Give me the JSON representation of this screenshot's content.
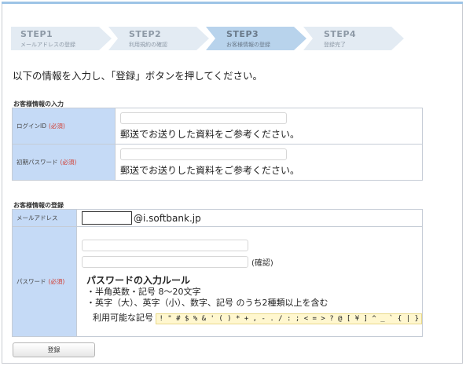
{
  "steps": [
    {
      "num": "STEP1",
      "desc": "メールアドレスの登録",
      "active": false
    },
    {
      "num": "STEP2",
      "desc": "利用規約の確認",
      "active": false
    },
    {
      "num": "STEP3",
      "desc": "お客様情報の登録",
      "active": true
    },
    {
      "num": "STEP4",
      "desc": "登録完了",
      "active": false
    }
  ],
  "intro": "以下の情報を入力し、「登録」ボタンを押してください。",
  "section1": {
    "title": "お客様情報の入力",
    "rows": [
      {
        "label": "ログインID",
        "required": "(必須)",
        "note": "郵送でお送りした資料をご参考ください。"
      },
      {
        "label": "初期パスワード",
        "required": "(必須)",
        "note": "郵送でお送りした資料をご参考ください。"
      }
    ]
  },
  "section2": {
    "title": "お客様情報の登録",
    "email": {
      "label": "メールアドレス",
      "domain": "@i.softbank.jp"
    },
    "password": {
      "label": "パスワード",
      "required": "(必須)",
      "confirm": "(確認)",
      "rule_title": "パスワードの入力ルール",
      "rule1": "・半角英数・記号 8～20文字",
      "rule2": "・英字（大）、英字（小）、数字、記号 のうち2種類以上を含む",
      "symbols_label": "利用可能な記号",
      "symbols": "! \" # $ % & ' ( ) * + , - . / : ; < = > ? @ [ ¥ ] ^ _ ` { | }"
    }
  },
  "submit_label": "登録",
  "colors": {
    "label_bg": "#c5daf6",
    "step_bg": "#e3ebf3",
    "step_active_bg": "#b8d3ec",
    "required": "#d23a2e",
    "symbols_bg": "#fff7cf"
  }
}
